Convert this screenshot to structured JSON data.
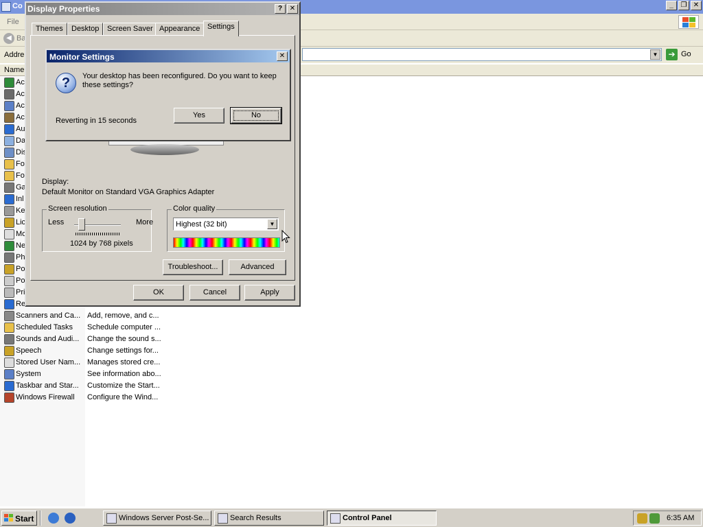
{
  "control_panel": {
    "title": "Co",
    "menu_file": "File",
    "back_label": "Ba",
    "address_label": "Addre",
    "go_label": "Go",
    "column_name": "Name",
    "items": [
      {
        "name": "Ac",
        "comment": "",
        "icon": "accessibility-icon",
        "color": "#2e8b3a"
      },
      {
        "name": "Ac",
        "comment": "",
        "icon": "add-hardware-icon",
        "color": "#6a6a6a"
      },
      {
        "name": "Ac",
        "comment": "",
        "icon": "add-remove-programs-icon",
        "color": "#5b7fc7"
      },
      {
        "name": "Ac",
        "comment": "",
        "icon": "administrative-tools-icon",
        "color": "#8a6d3b"
      },
      {
        "name": "Au",
        "comment": "",
        "icon": "automatic-updates-icon",
        "color": "#2a6bd1"
      },
      {
        "name": "Da",
        "comment": "",
        "icon": "date-time-icon",
        "color": "#8cb0e0"
      },
      {
        "name": "Dis",
        "comment": "",
        "icon": "display-icon",
        "color": "#6d8fc7"
      },
      {
        "name": "Fo",
        "comment": "",
        "icon": "folder-options-icon",
        "color": "#e8c04a"
      },
      {
        "name": "Fo",
        "comment": "",
        "icon": "fonts-icon",
        "color": "#e8c04a"
      },
      {
        "name": "Ga",
        "comment": "",
        "icon": "game-controllers-icon",
        "color": "#777777"
      },
      {
        "name": "Inl",
        "comment": "",
        "icon": "internet-options-icon",
        "color": "#2a6bd1"
      },
      {
        "name": "Ke",
        "comment": "",
        "icon": "keyboard-icon",
        "color": "#999999"
      },
      {
        "name": "Lic",
        "comment": "",
        "icon": "licensing-icon",
        "color": "#c9a227"
      },
      {
        "name": "Mo",
        "comment": "",
        "icon": "mouse-icon",
        "color": "#dddddd"
      },
      {
        "name": "Ne",
        "comment": "",
        "icon": "network-connections-icon",
        "color": "#2e8b3a"
      },
      {
        "name": "Ph",
        "comment": "",
        "icon": "phone-modem-icon",
        "color": "#777777"
      },
      {
        "name": "Po",
        "comment": "",
        "icon": "portable-media-icon",
        "color": "#c9a227"
      },
      {
        "name": "Po",
        "comment": "",
        "icon": "power-options-icon",
        "color": "#cccccc"
      },
      {
        "name": "Pri",
        "comment": "",
        "icon": "printers-faxes-icon",
        "color": "#bbbbbb"
      },
      {
        "name": "Re",
        "comment": "",
        "icon": "regional-language-icon",
        "color": "#2a6bd1"
      },
      {
        "name": "Scanners and Ca...",
        "comment": "Add, remove, and c...",
        "icon": "scanners-cameras-icon",
        "color": "#888888"
      },
      {
        "name": "Scheduled Tasks",
        "comment": "Schedule computer ...",
        "icon": "scheduled-tasks-icon",
        "color": "#e8c04a"
      },
      {
        "name": "Sounds and Audi...",
        "comment": "Change the sound s...",
        "icon": "sounds-audio-icon",
        "color": "#777777"
      },
      {
        "name": "Speech",
        "comment": "Change settings for...",
        "icon": "speech-icon",
        "color": "#c9a227"
      },
      {
        "name": "Stored User Nam...",
        "comment": "Manages stored cre...",
        "icon": "stored-user-names-icon",
        "color": "#dddddd"
      },
      {
        "name": "System",
        "comment": "See information abo...",
        "icon": "system-icon",
        "color": "#5b7fc7"
      },
      {
        "name": "Taskbar and Star...",
        "comment": "Customize the Start...",
        "icon": "taskbar-start-menu-icon",
        "color": "#2a6bd1"
      },
      {
        "name": "Windows Firewall",
        "comment": "Configure the Wind...",
        "icon": "windows-firewall-icon",
        "color": "#b5442a"
      }
    ]
  },
  "display_properties": {
    "title": "Display Properties",
    "tabs": [
      "Themes",
      "Desktop",
      "Screen Saver",
      "Appearance",
      "Settings"
    ],
    "active_tab": "Settings",
    "display_label": "Display:",
    "display_value": "Default Monitor on Standard VGA Graphics Adapter",
    "resolution": {
      "group_title": "Screen resolution",
      "less_label": "Less",
      "more_label": "More",
      "value": "1024 by 768 pixels"
    },
    "color_quality": {
      "group_title": "Color quality",
      "selected": "Highest (32 bit)"
    },
    "troubleshoot_label": "Troubleshoot...",
    "advanced_label": "Advanced",
    "ok_label": "OK",
    "cancel_label": "Cancel",
    "apply_label": "Apply"
  },
  "monitor_settings": {
    "title": "Monitor Settings",
    "message": "Your desktop has been reconfigured.  Do you want to keep these settings?",
    "reverting_text": "Reverting in 15 seconds",
    "yes_label": "Yes",
    "no_label": "No"
  },
  "taskbar": {
    "start_label": "Start",
    "tasks": [
      {
        "label": "Windows Server Post-Se...",
        "active": false
      },
      {
        "label": "Search Results",
        "active": false
      },
      {
        "label": "Control Panel",
        "active": true
      }
    ],
    "clock": "6:35 AM"
  }
}
